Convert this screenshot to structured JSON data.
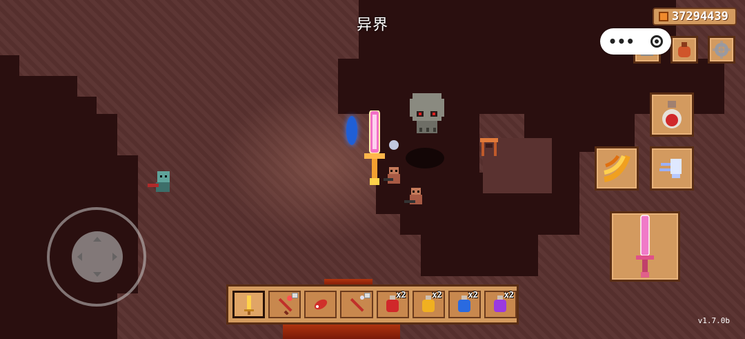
{
  "hud": {
    "area_title": "异界",
    "currency_amount": "37294439",
    "version": "v1.7.0b"
  },
  "icons": {
    "currency": "coin-icon",
    "menu": "more-dots-icon",
    "close": "target-icon",
    "top_buttons": [
      "pet-icon",
      "bag-icon",
      "gear-icon"
    ],
    "actions": [
      "potion-icon",
      "bananas-icon",
      "ghost-dash-icon",
      "pink-sword-icon"
    ]
  },
  "hotbar": {
    "slots": [
      {
        "item": "golden-sword-icon",
        "selected": true,
        "locked": false,
        "count": ""
      },
      {
        "item": "red-staff-icon",
        "selected": false,
        "locked": true,
        "count": ""
      },
      {
        "item": "red-fish-icon",
        "selected": false,
        "locked": false,
        "count": ""
      },
      {
        "item": "red-wand-icon",
        "selected": false,
        "locked": true,
        "count": ""
      },
      {
        "item": "red-potion-icon",
        "selected": false,
        "locked": false,
        "count": "x2"
      },
      {
        "item": "yellow-potion-icon",
        "selected": false,
        "locked": false,
        "count": "x2"
      },
      {
        "item": "blue-potion-icon",
        "selected": false,
        "locked": false,
        "count": "x2"
      },
      {
        "item": "purple-potion-icon",
        "selected": false,
        "locked": false,
        "count": "x2"
      }
    ]
  },
  "colors": {
    "panel": "#d39a5f",
    "panel_border": "#5a2e14",
    "rock": "#5a3230",
    "void": "#2a0f0f",
    "lava": "#b2350f"
  }
}
